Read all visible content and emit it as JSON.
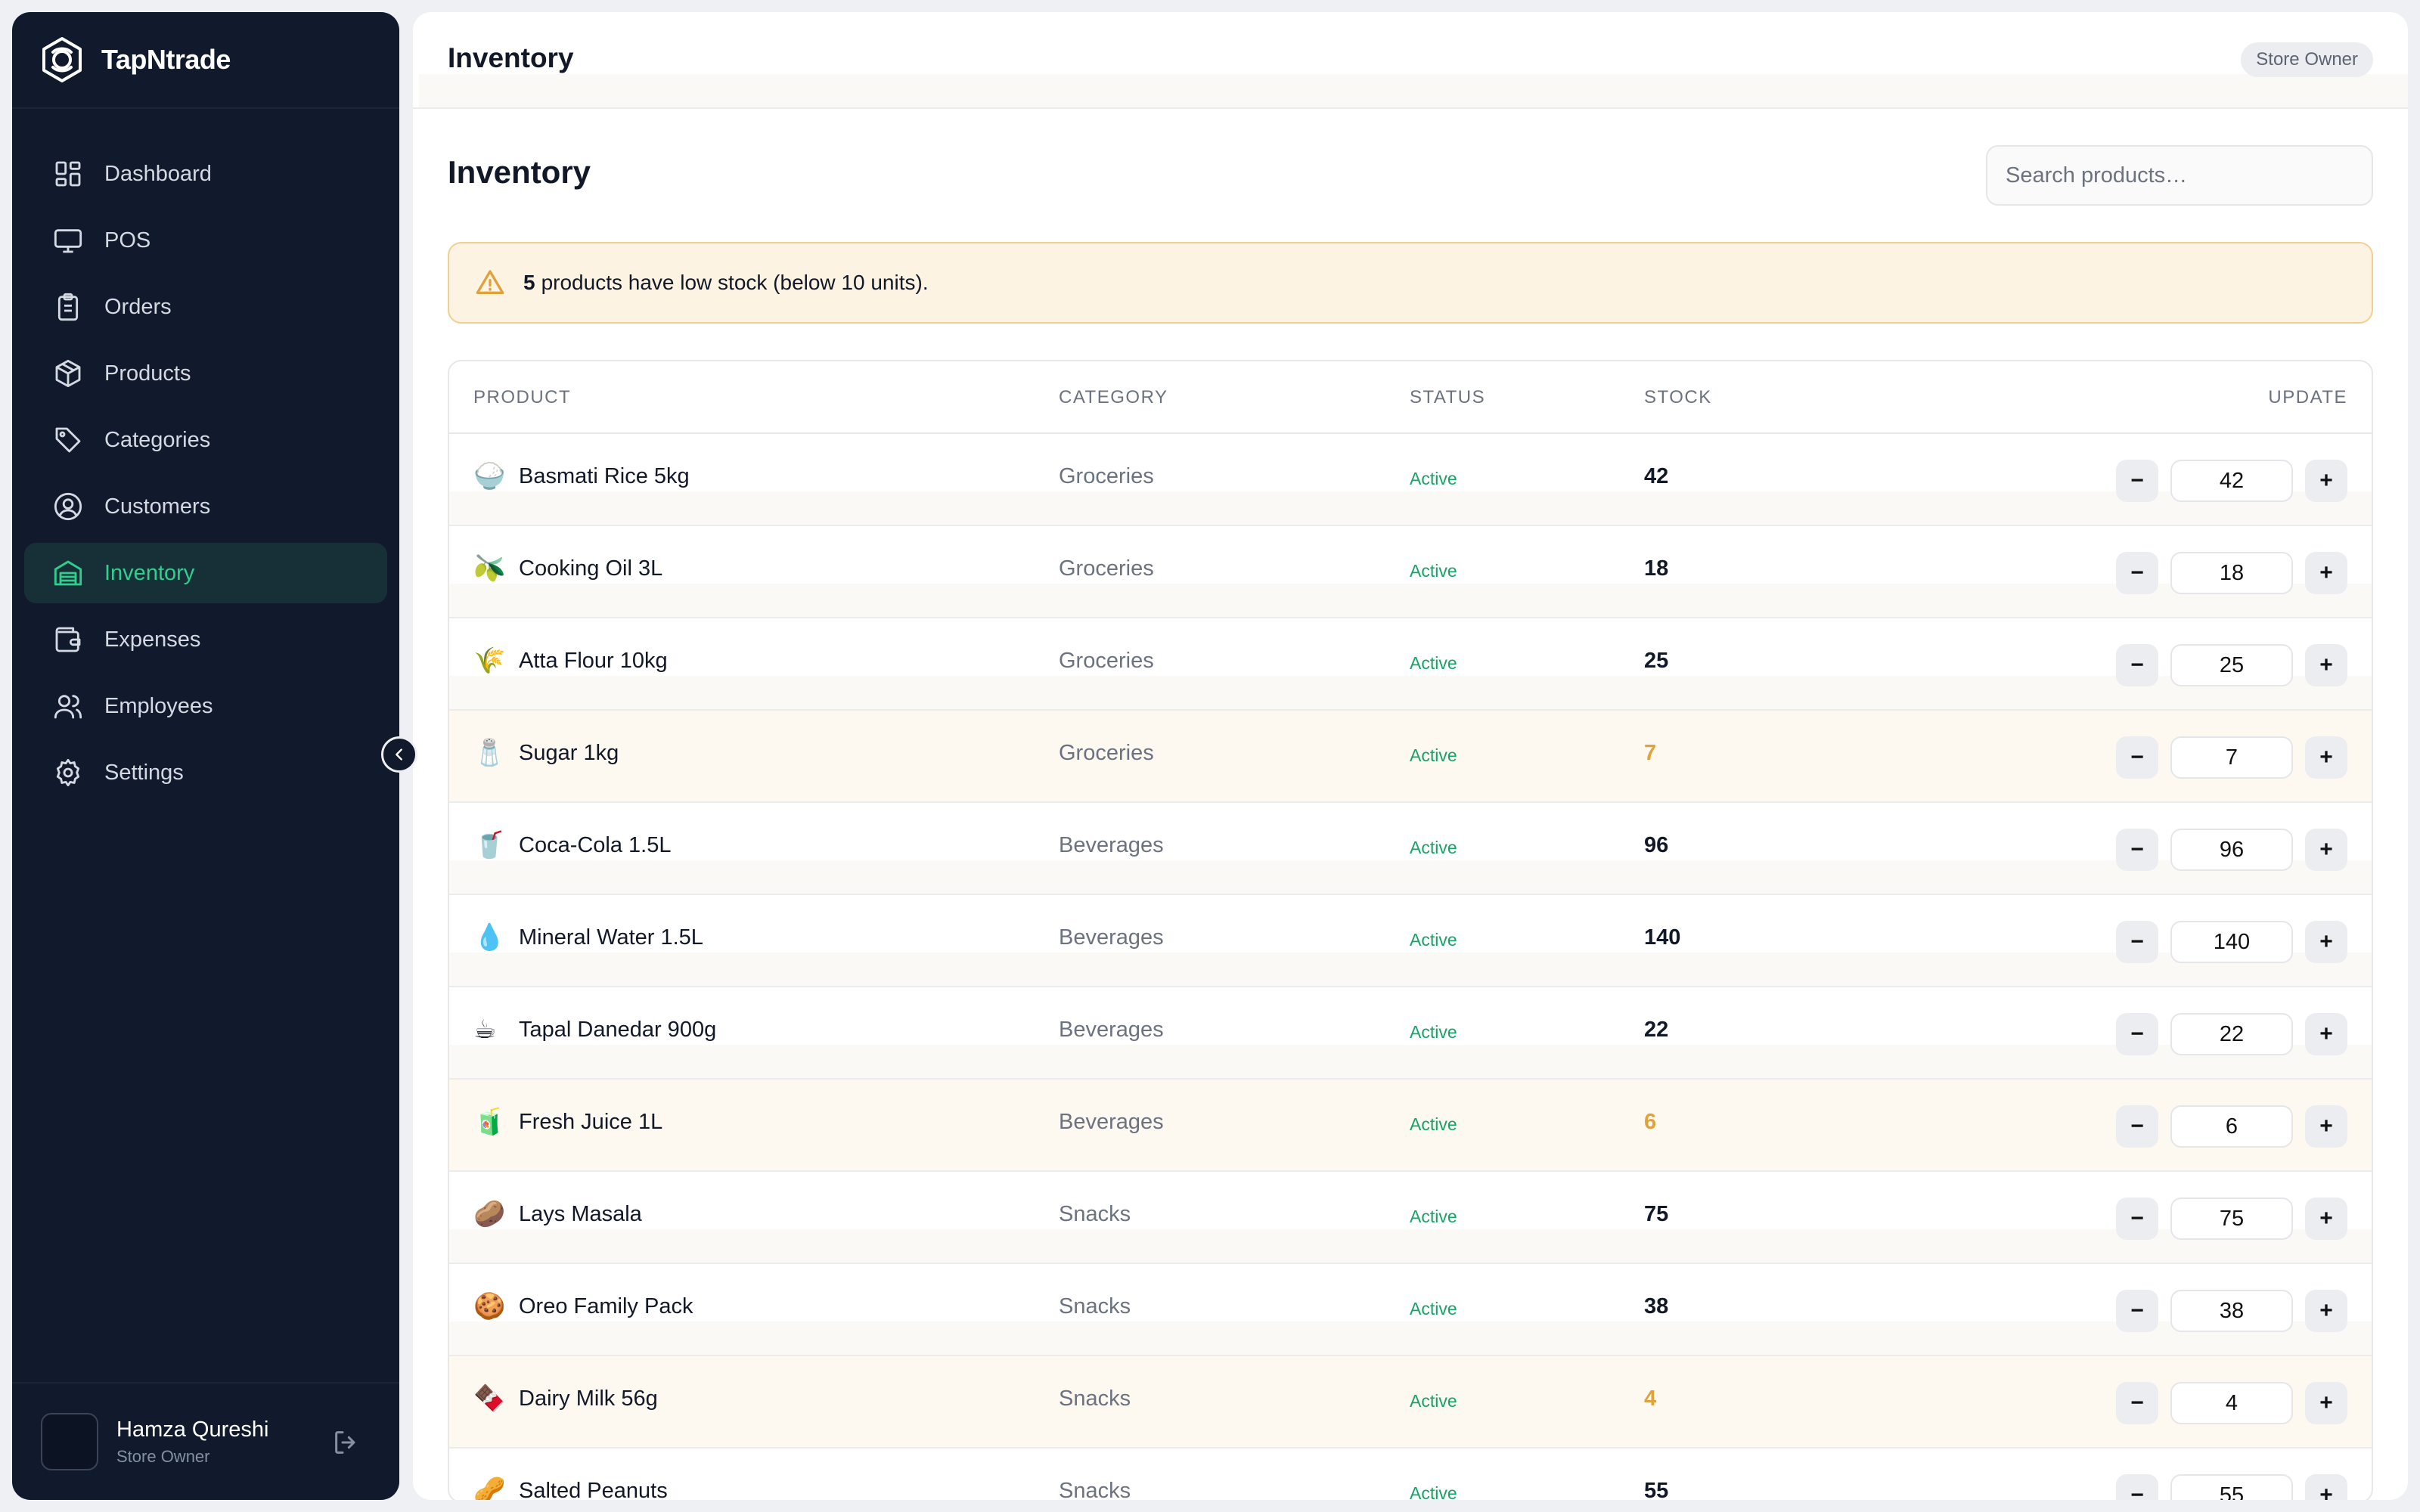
{
  "app": {
    "name": "TapNtrade"
  },
  "sidebar": {
    "items": [
      {
        "label": "Dashboard",
        "icon": "grid-icon"
      },
      {
        "label": "POS",
        "icon": "monitor-icon"
      },
      {
        "label": "Orders",
        "icon": "clipboard-icon"
      },
      {
        "label": "Products",
        "icon": "box-icon"
      },
      {
        "label": "Categories",
        "icon": "tag-icon"
      },
      {
        "label": "Customers",
        "icon": "user-circle-icon"
      },
      {
        "label": "Inventory",
        "icon": "warehouse-icon",
        "active": true
      },
      {
        "label": "Expenses",
        "icon": "wallet-icon"
      },
      {
        "label": "Employees",
        "icon": "users-icon"
      },
      {
        "label": "Settings",
        "icon": "gear-icon"
      }
    ],
    "user": {
      "name": "Hamza Qureshi",
      "role": "Store Owner"
    }
  },
  "header": {
    "title": "Inventory",
    "role_badge": "Store Owner"
  },
  "page": {
    "title": "Inventory",
    "search_placeholder": "Search products…",
    "alert": {
      "count": "5",
      "text": "products have low stock (below 10 units)."
    }
  },
  "table": {
    "columns": [
      "PRODUCT",
      "CATEGORY",
      "STATUS",
      "STOCK",
      "UPDATE"
    ],
    "rows": [
      {
        "emoji": "🍚",
        "name": "Basmati Rice 5kg",
        "category": "Groceries",
        "status": "Active",
        "stock": "42",
        "low": false
      },
      {
        "emoji": "🫒",
        "name": "Cooking Oil 3L",
        "category": "Groceries",
        "status": "Active",
        "stock": "18",
        "low": false
      },
      {
        "emoji": "🌾",
        "name": "Atta Flour 10kg",
        "category": "Groceries",
        "status": "Active",
        "stock": "25",
        "low": false
      },
      {
        "emoji": "🧂",
        "name": "Sugar 1kg",
        "category": "Groceries",
        "status": "Active",
        "stock": "7",
        "low": true
      },
      {
        "emoji": "🥤",
        "name": "Coca-Cola 1.5L",
        "category": "Beverages",
        "status": "Active",
        "stock": "96",
        "low": false
      },
      {
        "emoji": "💧",
        "name": "Mineral Water 1.5L",
        "category": "Beverages",
        "status": "Active",
        "stock": "140",
        "low": false
      },
      {
        "emoji": "☕",
        "name": "Tapal Danedar 900g",
        "category": "Beverages",
        "status": "Active",
        "stock": "22",
        "low": false
      },
      {
        "emoji": "🧃",
        "name": "Fresh Juice 1L",
        "category": "Beverages",
        "status": "Active",
        "stock": "6",
        "low": true
      },
      {
        "emoji": "🥔",
        "name": "Lays Masala",
        "category": "Snacks",
        "status": "Active",
        "stock": "75",
        "low": false
      },
      {
        "emoji": "🍪",
        "name": "Oreo Family Pack",
        "category": "Snacks",
        "status": "Active",
        "stock": "38",
        "low": false
      },
      {
        "emoji": "🍫",
        "name": "Dairy Milk 56g",
        "category": "Snacks",
        "status": "Active",
        "stock": "4",
        "low": true
      },
      {
        "emoji": "🥜",
        "name": "Salted Peanuts",
        "category": "Snacks",
        "status": "Active",
        "stock": "55",
        "low": false
      }
    ]
  },
  "colors": {
    "sidebar_bg": "#101a2c",
    "accent": "#2fcf8e",
    "low_stock": "#e0a23a",
    "status_active": "#16a366"
  }
}
